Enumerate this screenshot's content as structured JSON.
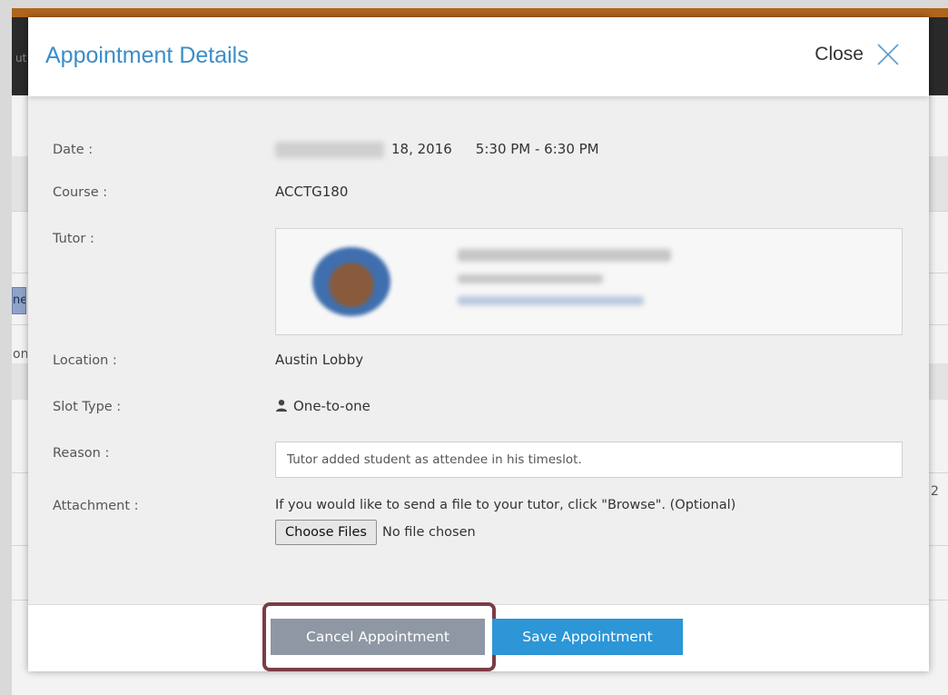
{
  "background": {
    "frag_top": "ut",
    "frag_mid": "on",
    "frag_tag": "ne",
    "frag_right": "2"
  },
  "modal": {
    "title": "Appointment Details",
    "close_label": "Close"
  },
  "fields": {
    "date_label": "Date :",
    "date_value": "18, 2016",
    "time_value": "5:30 PM - 6:30 PM",
    "course_label": "Course :",
    "course_value": "ACCTG180",
    "tutor_label": "Tutor :",
    "location_label": "Location :",
    "location_value": "Austin Lobby",
    "slot_type_label": "Slot Type :",
    "slot_type_value": "One-to-one",
    "reason_label": "Reason :",
    "reason_value": "Tutor added student as attendee in his timeslot.",
    "attachment_label": "Attachment :",
    "attachment_hint": "If you would like to send a file to your tutor, click \"Browse\". (Optional)",
    "choose_files_label": "Choose Files",
    "file_status": "No file chosen"
  },
  "footer": {
    "cancel_label": "Cancel Appointment",
    "save_label": "Save Appointment"
  },
  "colors": {
    "accent": "#3a8dc9",
    "save_button": "#2c96d6",
    "cancel_button": "#8e97a3",
    "highlight_ring": "#7a3d45",
    "top_bar": "#b0651e"
  },
  "icons": {
    "close": "close-icon",
    "slot_type": "person-icon"
  }
}
